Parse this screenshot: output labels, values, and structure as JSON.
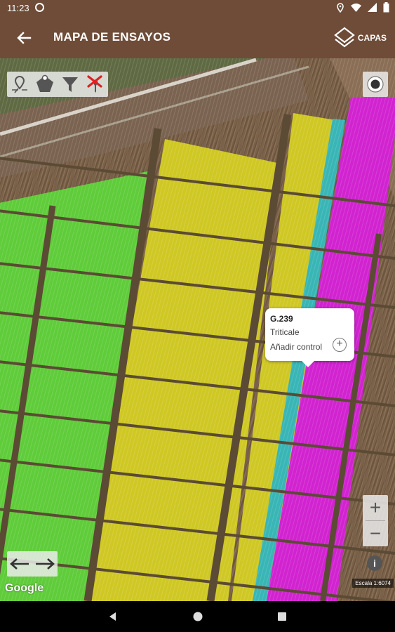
{
  "status_bar": {
    "time": "11:23"
  },
  "app_bar": {
    "title": "MAPA DE ENSAYOS",
    "layers_label": "CAPAS"
  },
  "popup": {
    "code": "G.239",
    "crop": "Triticale",
    "action_label": "Añadir control"
  },
  "map": {
    "attribution": "Google",
    "scale_label": "Escala 1:6074",
    "zoom_in": "+",
    "zoom_out": "−",
    "info": "i",
    "colors": {
      "green": "#5fcc3a",
      "yellow": "#cfc824",
      "cyan": "#39b5b5",
      "magenta": "#d123d0",
      "soil": "#7b6148",
      "road": "#d8d2c8"
    }
  },
  "toolbar": {
    "tools": [
      "location-filter-icon",
      "polygon-icon",
      "filter-icon",
      "clear-filter-icon"
    ]
  }
}
